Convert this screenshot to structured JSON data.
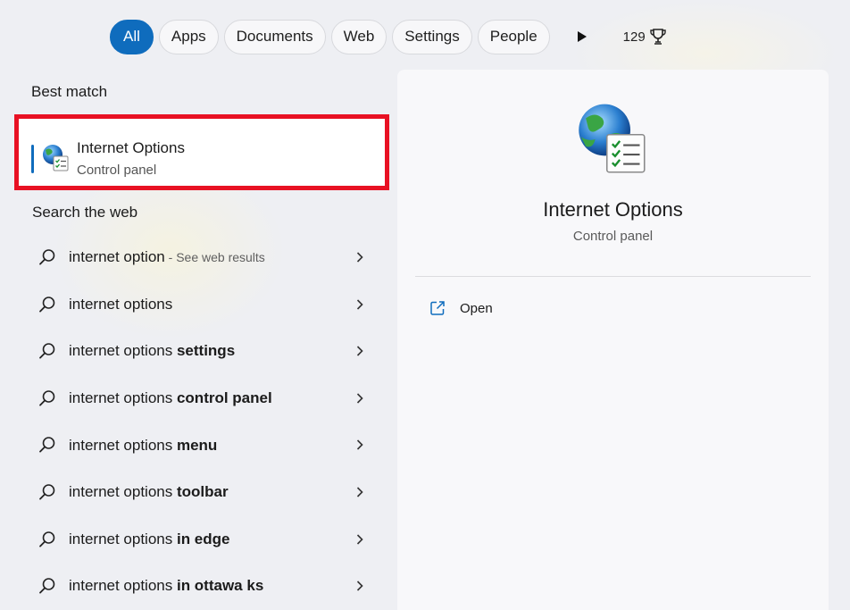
{
  "filters": {
    "tabs": [
      {
        "label": "All",
        "active": true
      },
      {
        "label": "Apps"
      },
      {
        "label": "Documents"
      },
      {
        "label": "Web"
      },
      {
        "label": "Settings"
      },
      {
        "label": "People"
      }
    ],
    "more_icon": "play-icon",
    "points": "129",
    "points_icon": "trophy-icon",
    "accent": "#0f6cbd"
  },
  "best_match": {
    "heading": "Best match",
    "title": "Internet Options",
    "subtitle": "Control panel",
    "highlight_color": "#e81123"
  },
  "web": {
    "heading": "Search the web",
    "items": [
      {
        "prefix": "internet option",
        "bold": "",
        "hint": " - See web results"
      },
      {
        "prefix": "internet options",
        "bold": "",
        "hint": ""
      },
      {
        "prefix": "internet options ",
        "bold": "settings",
        "hint": ""
      },
      {
        "prefix": "internet options ",
        "bold": "control panel",
        "hint": ""
      },
      {
        "prefix": "internet options ",
        "bold": "menu",
        "hint": ""
      },
      {
        "prefix": "internet options ",
        "bold": "toolbar",
        "hint": ""
      },
      {
        "prefix": "internet options ",
        "bold": "in edge",
        "hint": ""
      },
      {
        "prefix": "internet options ",
        "bold": "in ottawa ks",
        "hint": ""
      }
    ]
  },
  "detail": {
    "title": "Internet Options",
    "subtitle": "Control panel",
    "actions": [
      {
        "label": "Open",
        "icon": "open-external-icon"
      }
    ]
  }
}
